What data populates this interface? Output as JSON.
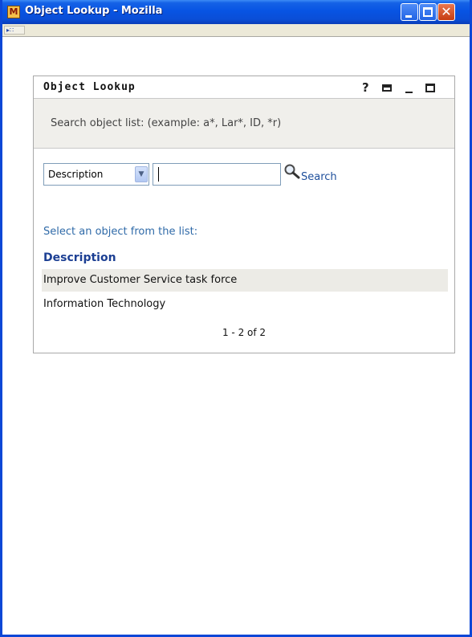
{
  "window": {
    "title": "Object Lookup - Mozilla",
    "app_icon": "mozilla-app-icon",
    "controls": [
      "minimize-icon",
      "maximize-icon",
      "close-icon"
    ]
  },
  "portlet": {
    "title": "Object Lookup",
    "header_icons": [
      "help-icon",
      "print-icon",
      "minimize-icon",
      "maximize-icon"
    ],
    "help_glyph": "?",
    "hint": "Search object list: (example: a*, Lar*, ID, *r)"
  },
  "search": {
    "field_select": {
      "value": "Description"
    },
    "input_value": "",
    "button_label": "Search"
  },
  "results": {
    "prompt": "Select an object from the list:",
    "column_header": "Description",
    "rows": [
      {
        "description": "Improve Customer Service task force"
      },
      {
        "description": "Information Technology"
      }
    ],
    "pager": "1 - 2 of 2"
  }
}
